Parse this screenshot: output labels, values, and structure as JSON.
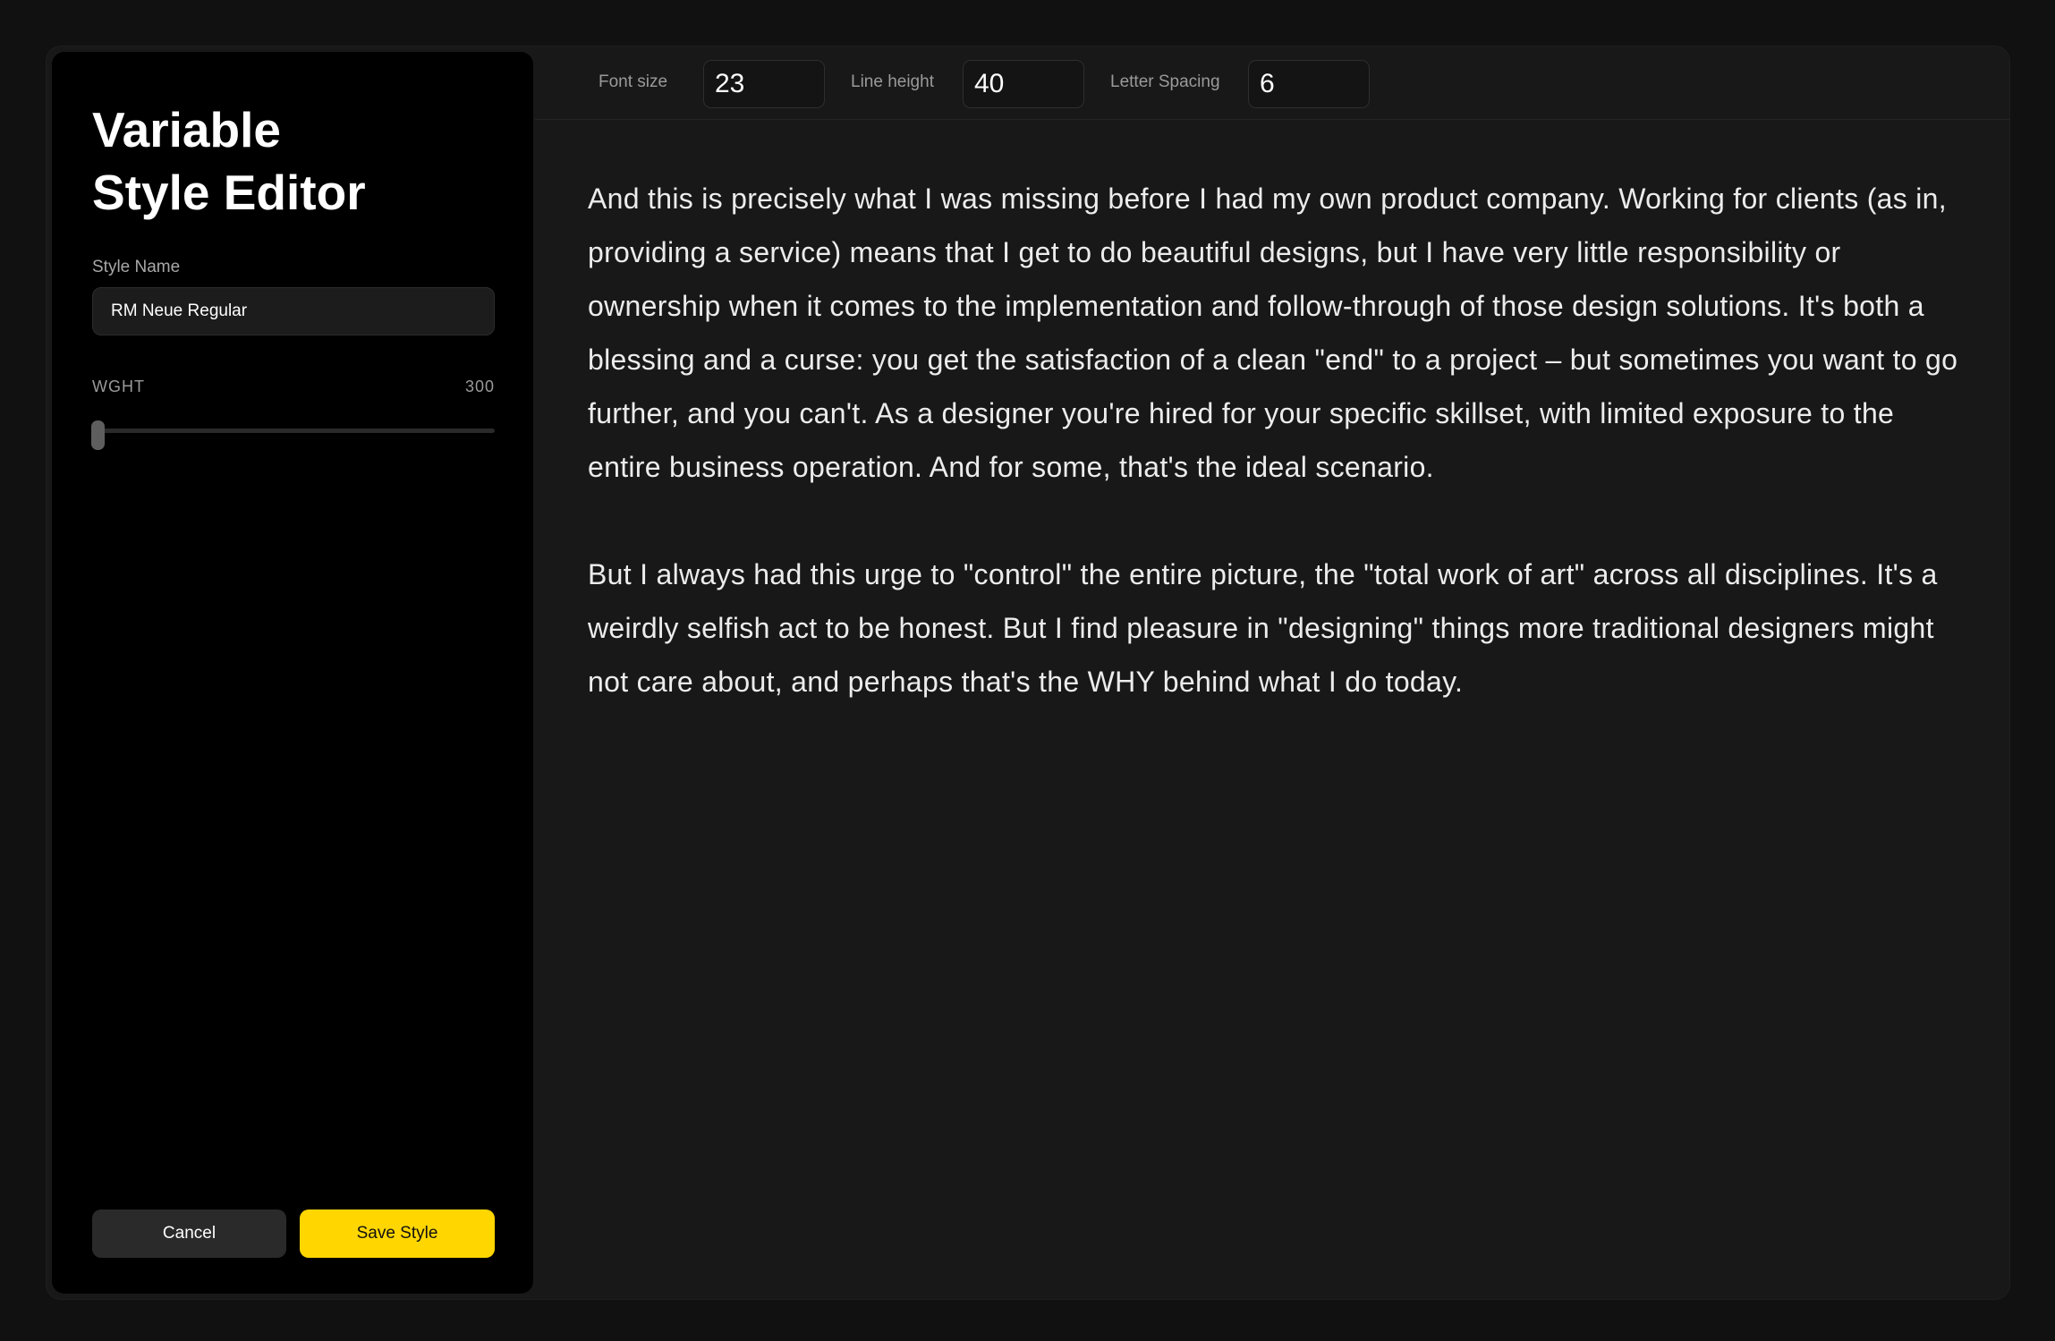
{
  "sidebar": {
    "title_line1": "Variable",
    "title_line2": "Style Editor",
    "style_name_label": "Style Name",
    "style_name_value": "RM Neue Regular",
    "axis_name": "WGHT",
    "axis_value": "300",
    "axis_level_fraction": 0.0,
    "cancel_label": "Cancel",
    "save_label": "Save Style"
  },
  "toolbar": {
    "font_size_label": "Font size",
    "font_size_value": "23",
    "line_height_label": "Line height",
    "line_height_value": "40",
    "letter_spacing_label": "Letter Spacing",
    "letter_spacing_value": "6"
  },
  "editor": {
    "paragraphs": [
      "And this is precisely what I was missing before I had my own product company. Working for clients (as in, providing a service) means that I get to do beautiful designs, but I have very little responsibility or ownership when it comes to the implementation and follow-through of those design solutions. It's both a blessing and a curse: you get the satisfaction of a clean \"end\" to a project – but sometimes you want to go further, and you can't. As a designer you're hired for your specific skillset, with limited exposure to the entire business operation. And for some, that's the ideal scenario.",
      "But I always had this urge to \"control\" the entire picture, the \"total work of art\" across all disciplines. It's a weirdly selfish act to be honest. But I find pleasure in \"designing\" things more traditional designers might not care about, and perhaps that's the WHY behind what I do today."
    ]
  },
  "colors": {
    "accent": "#ffd600",
    "sidebar_bg": "#000000",
    "panel_bg": "#181818"
  }
}
